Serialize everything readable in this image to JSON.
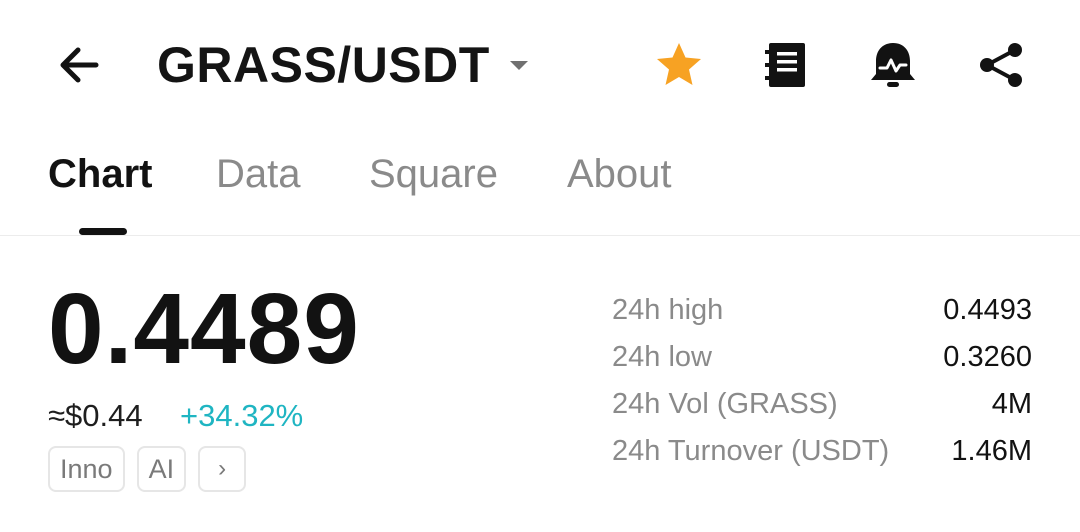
{
  "header": {
    "pair": "GRASS/USDT",
    "icons": {
      "back": "arrow-left-icon",
      "favorite": "star-icon",
      "notes": "notebook-icon",
      "alert": "price-alert-bell-icon",
      "share": "share-icon"
    },
    "colors": {
      "favorite": "#f7a223"
    }
  },
  "tabs": [
    {
      "label": "Chart",
      "active": true
    },
    {
      "label": "Data",
      "active": false
    },
    {
      "label": "Square",
      "active": false
    },
    {
      "label": "About",
      "active": false
    }
  ],
  "price": {
    "last": "0.4489",
    "fiat": "≈$0.44",
    "change": "+34.32%",
    "change_color": "#1fb5c2"
  },
  "tags": [
    "Inno",
    "AI",
    "›"
  ],
  "stats": [
    {
      "label": "24h high",
      "value": "0.4493"
    },
    {
      "label": "24h low",
      "value": "0.3260"
    },
    {
      "label": "24h Vol (GRASS)",
      "value": "4M"
    },
    {
      "label": "24h Turnover (USDT)",
      "value": "1.46M"
    }
  ]
}
